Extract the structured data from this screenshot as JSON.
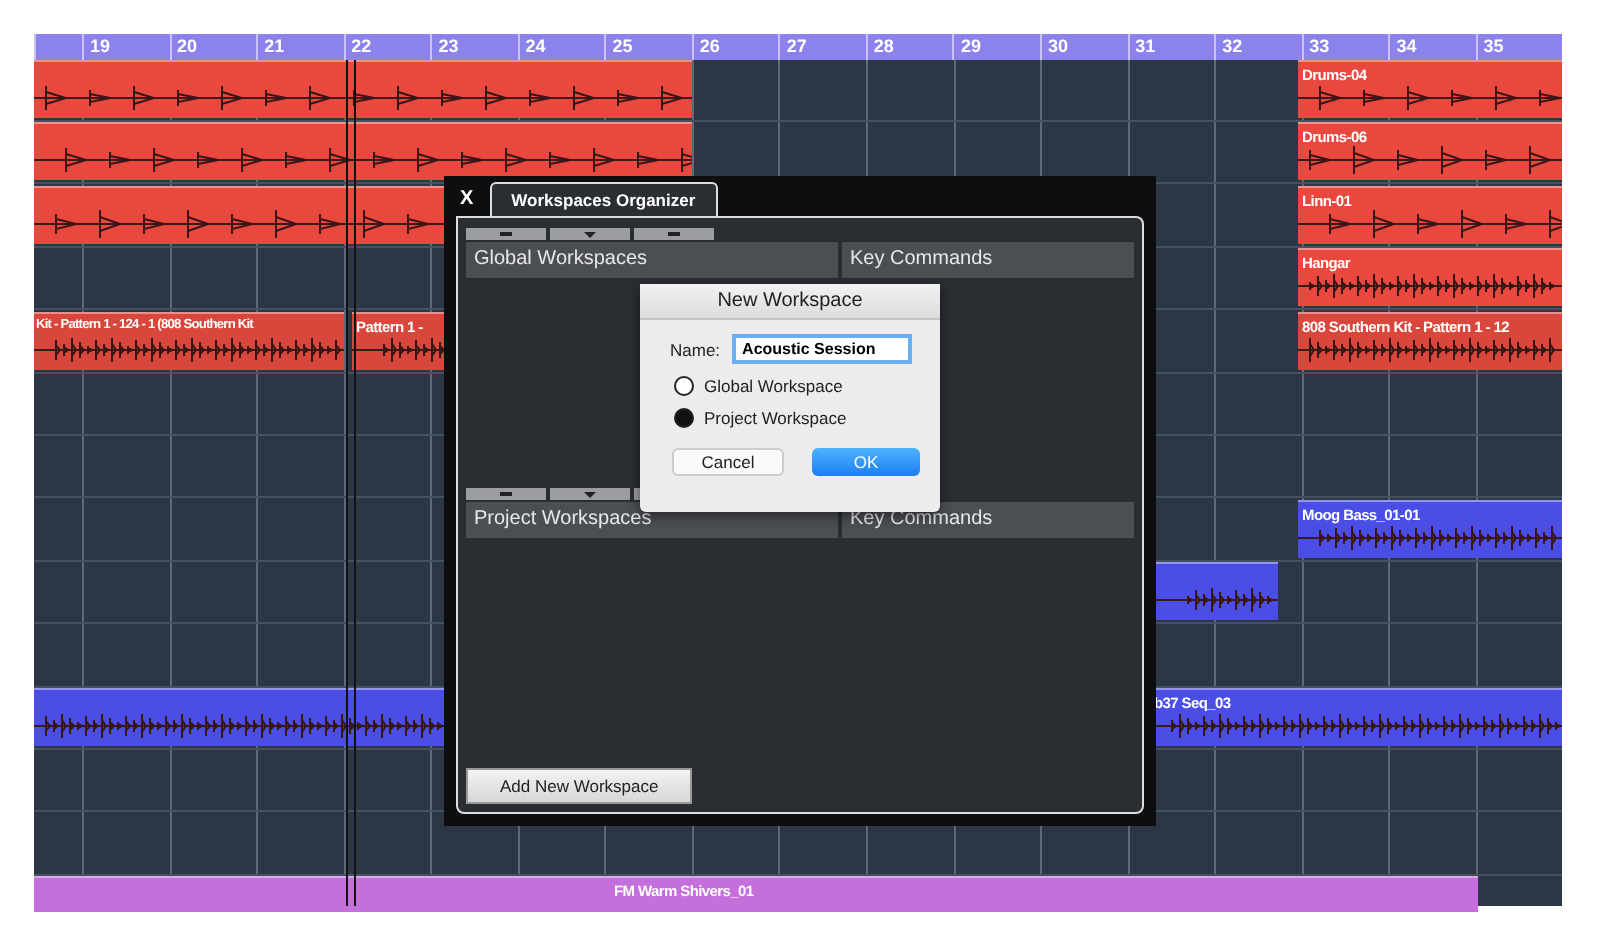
{
  "ruler": {
    "bars": [
      "19",
      "20",
      "21",
      "22",
      "23",
      "24",
      "25",
      "26",
      "27",
      "28",
      "29",
      "30",
      "31",
      "32",
      "33",
      "34",
      "35"
    ]
  },
  "clips": [
    {
      "color": "#e8483d"
    },
    {
      "name": "Drums-04",
      "color": "#e8483d"
    },
    {
      "color": "#e8483d"
    },
    {
      "name": "Drums-06",
      "color": "#e8483d"
    },
    {
      "color": "#e8483d"
    },
    {
      "name": "Linn-01",
      "color": "#e8483d"
    },
    {
      "name": "Hangar",
      "color": "#e8483d"
    },
    {
      "name": "Kit - Pattern 1 - 124 - 1 (808 Southern Kit",
      "color": "#d9473c"
    },
    {
      "name": "Pattern 1 -",
      "color": "#d9473c"
    },
    {
      "name": "808 Southern Kit - Pattern 1 - 12",
      "color": "#d9473c"
    },
    {
      "name": "Moog Bass_01-01",
      "color": "#4a4ee6"
    },
    {
      "color": "#4a4ee6"
    },
    {
      "color": "#4a4ee6"
    },
    {
      "name": "b37 Seq_03",
      "color": "#4a4ee6"
    },
    {
      "color": "#c56fdc"
    },
    {
      "name": "FM Warm Shivers_01",
      "color": "#c56fdc"
    }
  ],
  "organizer": {
    "close": "X",
    "tab": {
      "label": "Workspaces Organizer",
      "selected": true
    },
    "global_section": {
      "headers": [
        "Global Workspaces",
        "Key Commands"
      ]
    },
    "project_section": {
      "headers": [
        "Project Workspaces",
        "Key Commands"
      ]
    },
    "add_button": "Add New Workspace"
  },
  "new_workspace_dialog": {
    "title": "New Workspace",
    "name_label": "Name:",
    "name_value": "Acoustic Session",
    "options": [
      {
        "label": "Global Workspace",
        "selected": false
      },
      {
        "label": "Project Workspace",
        "selected": true
      }
    ],
    "buttons": [
      {
        "label": "Cancel",
        "kind": "secondary"
      },
      {
        "label": "OK",
        "kind": "primary"
      }
    ]
  }
}
